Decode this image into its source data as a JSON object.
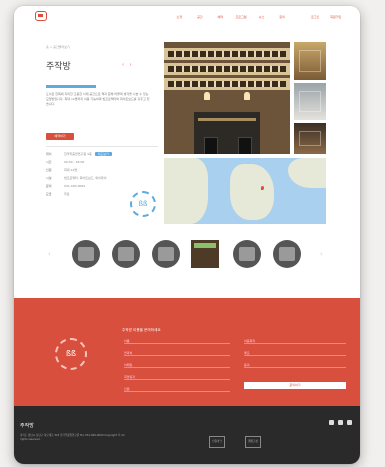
{
  "header": {
    "nav": [
      "소개",
      "공간",
      "예약",
      "프로그램",
      "뉴스",
      "문의",
      "로그인",
      "회원가입"
    ]
  },
  "space": {
    "breadcrumb": "홈 > 공간둘러보기",
    "title": "주작방",
    "description": "도서관 한쪽에 자리한 조용한 서재 공간으로 책과 함께 머물며 생각을 나눌 수 있는 모임방입니다. 최대 12명까지 이용 가능하며 빔프로젝터와 화이트보드를 갖추고 있습니다.",
    "cta_label": "예약하기",
    "info": [
      {
        "key": "위치",
        "value": "한국학중앙연구원 3층",
        "badge": "지도보기"
      },
      {
        "key": "시간",
        "value": "09:00 - 18:00"
      },
      {
        "key": "인원",
        "value": "최대 12명"
      },
      {
        "key": "시설",
        "value": "빔프로젝터, 화이트보드, 와이파이"
      },
      {
        "key": "문의",
        "value": "031-000-0000"
      },
      {
        "key": "요금",
        "value": "무료"
      }
    ],
    "mini_logo": "ßß"
  },
  "contact": {
    "title": "주작방 이용을 문의하세요",
    "left_fields": [
      "이름",
      "연락처",
      "이메일",
      "희망일자",
      "인원"
    ],
    "right_fields": [
      "이용목적",
      "메모",
      "동의"
    ],
    "submit_label": "문의하기",
    "logo_text": "ßß"
  },
  "footer": {
    "brand": "주작방",
    "address": "경기도 성남시 분당구 하오개로 323 한국학중앙연구원 Tel. 031-000-0000 Copyright © All rights reserved.",
    "badges": [
      "인증마크",
      "웹접근성"
    ]
  },
  "colors": {
    "accent": "#d84f3d",
    "blue": "#5ea9de",
    "footer": "#2a2a2a"
  }
}
